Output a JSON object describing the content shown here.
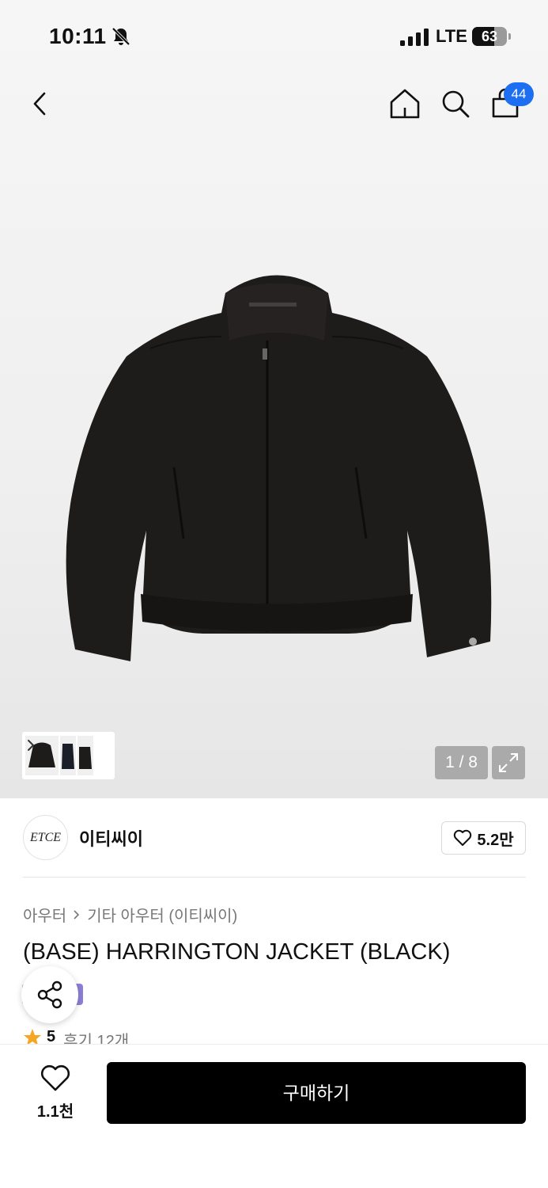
{
  "status_bar": {
    "time": "10:11",
    "network": "LTE",
    "battery_percent": 63,
    "battery_label": "63"
  },
  "nav": {
    "back_icon": "chevron-left-icon",
    "home_icon": "home-icon",
    "search_icon": "search-icon",
    "cart_icon": "shopping-bag-icon",
    "cart_count": "44"
  },
  "gallery": {
    "page_indicator": "1 / 8",
    "current_page": 1,
    "total_pages": 8,
    "expand_icon": "expand-icon"
  },
  "brand": {
    "logo_text": "ETCE",
    "name": "이티씨이",
    "like_count": "5.2만"
  },
  "product": {
    "breadcrumb": [
      "아우터",
      "기타 아우터 (이티씨이)"
    ],
    "title": "(BASE) HARRINGTON JACKET (BLACK)",
    "rating": "5",
    "review_text": "후기 12개"
  },
  "bottom_bar": {
    "wish_count": "1.1천",
    "buy_label": "구매하기"
  },
  "colors": {
    "cart_badge": "#1d6ef0",
    "buy_button": "#000000",
    "badge": "#8c7fd9",
    "star": "#f5a623"
  }
}
